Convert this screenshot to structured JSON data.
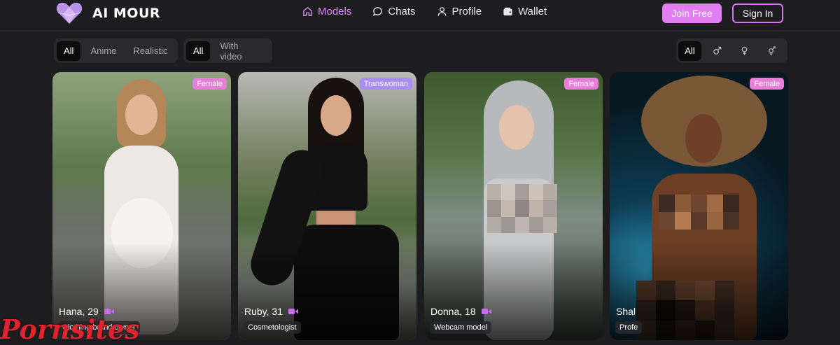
{
  "brand": {
    "name": "AI MOUR"
  },
  "nav": [
    {
      "label": "Models",
      "icon": "home-icon",
      "active": true
    },
    {
      "label": "Chats",
      "icon": "chat-icon",
      "active": false
    },
    {
      "label": "Profile",
      "icon": "user-icon",
      "active": false
    },
    {
      "label": "Wallet",
      "icon": "wallet-icon",
      "active": false
    }
  ],
  "auth": {
    "join_label": "Join Free",
    "signin_label": "Sign In"
  },
  "filters": {
    "style": [
      "All",
      "Anime",
      "Realistic"
    ],
    "style_selected": "All",
    "media": [
      "All",
      "With video"
    ],
    "media_selected": "All",
    "gender": {
      "all_label": "All",
      "options": [
        "male-icon",
        "female-icon",
        "trans-icon"
      ]
    }
  },
  "cards": [
    {
      "tag": "Female",
      "name": "Hana, 29",
      "occupation": "Clothing brand owner",
      "has_video": true
    },
    {
      "tag": "Transwoman",
      "name": "Ruby, 31",
      "occupation": "Cosmetologist",
      "has_video": true
    },
    {
      "tag": "Female",
      "name": "Donna, 18",
      "occupation": "Webcam model",
      "has_video": true
    },
    {
      "tag": "Female",
      "name": "Shal",
      "occupation": "Profe",
      "has_video": false
    }
  ],
  "watermark": "Pornsites",
  "colors": {
    "accent": "#e37ef2",
    "active_nav": "#d98cf3",
    "female_tag": "#e77ed7",
    "trans_tag": "#a98df0",
    "video_icon": "#c86cf0",
    "background": "#1d1d1f"
  }
}
